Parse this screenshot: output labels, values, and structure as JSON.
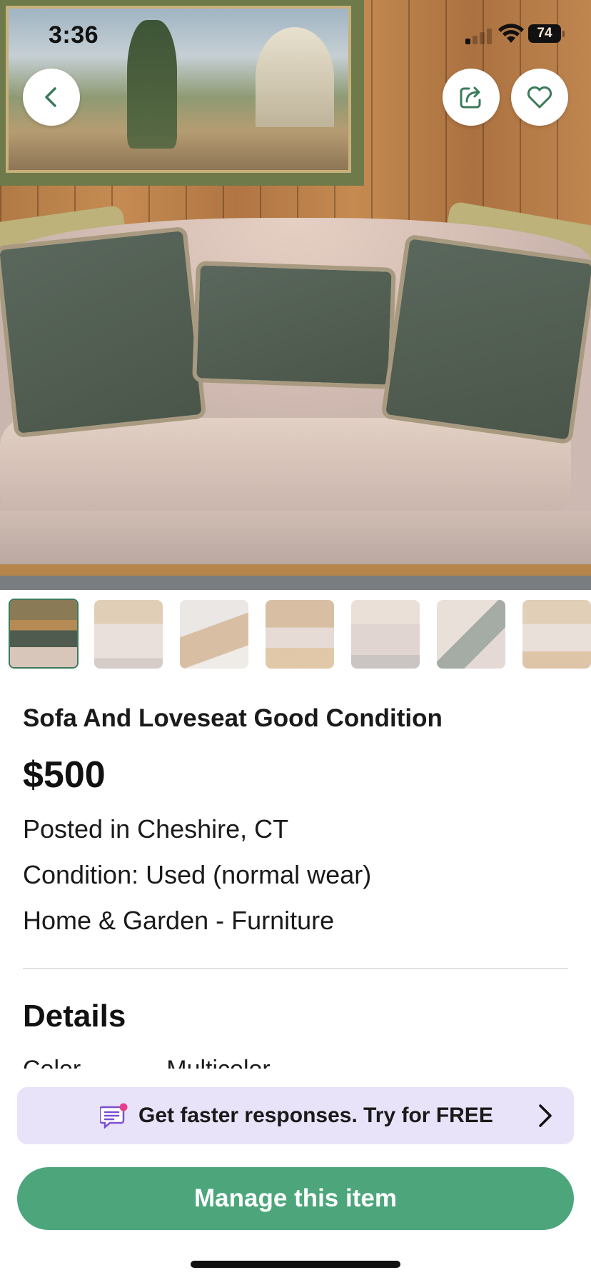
{
  "status_bar": {
    "time": "3:36",
    "battery": "74"
  },
  "hero": {
    "description_icon": "photo"
  },
  "overlay_buttons": {
    "back_icon": "chevron-left-icon",
    "share_icon": "share-icon",
    "favorite_icon": "heart-outline-icon",
    "accent_color": "#3b7a5a"
  },
  "thumbnails": [
    {
      "id": 1,
      "active": true
    },
    {
      "id": 2,
      "active": false
    },
    {
      "id": 3,
      "active": false
    },
    {
      "id": 4,
      "active": false
    },
    {
      "id": 5,
      "active": false
    },
    {
      "id": 6,
      "active": false
    },
    {
      "id": 7,
      "active": false
    }
  ],
  "listing": {
    "title": "Sofa And Loveseat Good Condition",
    "price": "$500",
    "location": "Posted in Cheshire, CT",
    "condition": "Condition: Used (normal wear)",
    "category": "Home & Garden - Furniture"
  },
  "details": {
    "heading": "Details",
    "peek_label": "Color",
    "peek_value": "Multicolor"
  },
  "promo": {
    "text": "Get faster responses.  Try for FREE",
    "icon": "message-badge-icon",
    "background": "#e9e3fa"
  },
  "cta": {
    "label": "Manage this item",
    "color": "#4da67b"
  }
}
